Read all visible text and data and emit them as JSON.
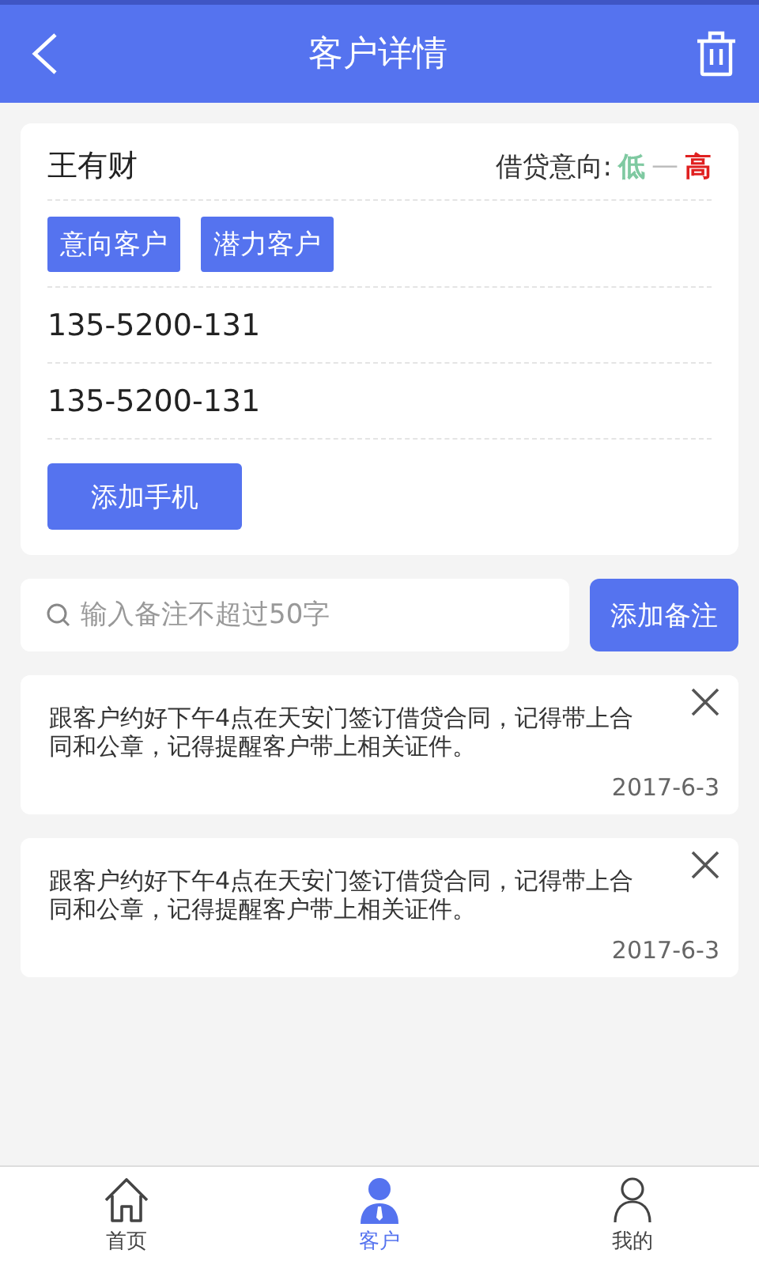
{
  "header": {
    "title": "客户详情"
  },
  "customer": {
    "name": "王有财",
    "intent_label": "借贷意向:",
    "intent_low": "低",
    "intent_sep": "—",
    "intent_high": "高",
    "tags": [
      "意向客户",
      "潜力客户"
    ],
    "phones": [
      "135-5200-131",
      "135-5200-131"
    ],
    "add_phone": "添加手机"
  },
  "note_input": {
    "placeholder": "输入备注不超过50字",
    "button": "添加备注"
  },
  "notes": [
    {
      "text": "跟客户约好下午4点在天安门签订借贷合同，记得带上合同和公章，记得提醒客户带上相关证件。",
      "date": "2017-6-3"
    },
    {
      "text": "跟客户约好下午4点在天安门签订借贷合同，记得带上合同和公章，记得提醒客户带上相关证件。",
      "date": "2017-6-3"
    }
  ],
  "tabs": [
    {
      "kind": "home",
      "label": "首页",
      "selected": false
    },
    {
      "kind": "customer",
      "label": "客户",
      "selected": true
    },
    {
      "kind": "profile",
      "label": "我的",
      "selected": false
    }
  ]
}
